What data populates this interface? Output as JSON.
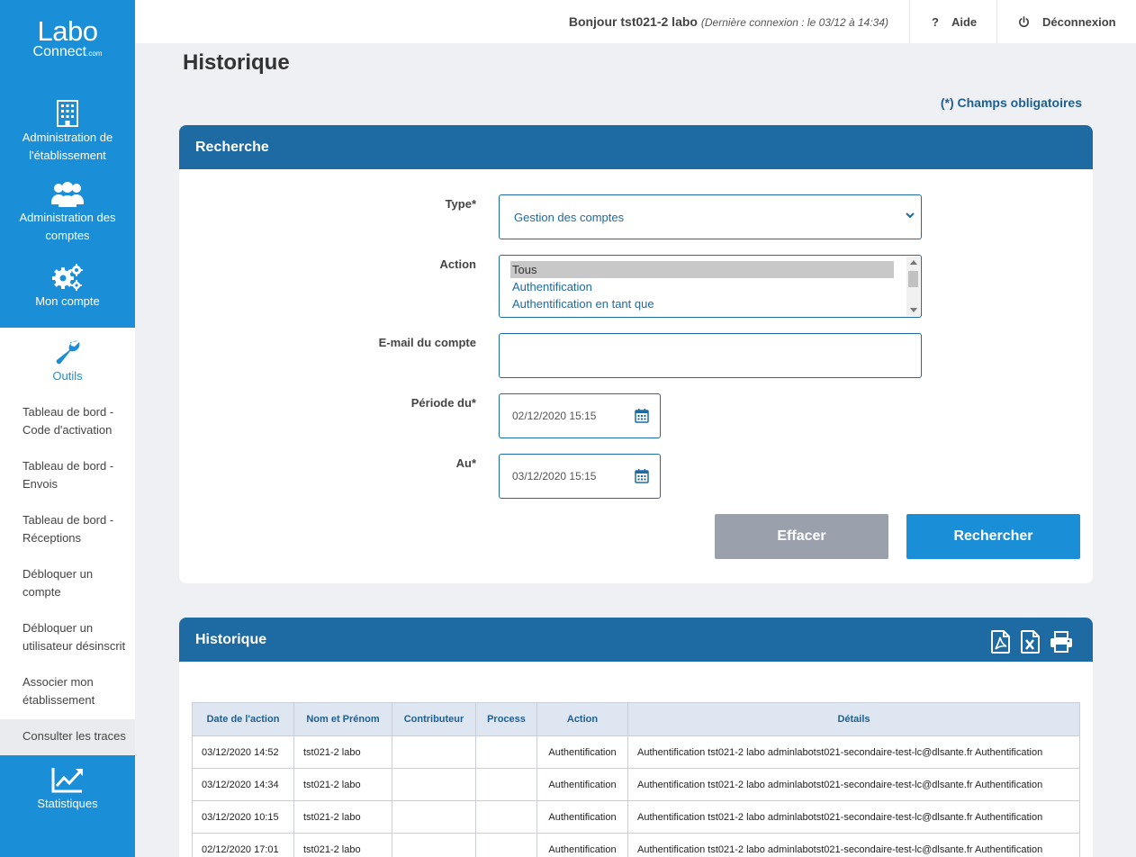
{
  "brand": {
    "line1": "Labo",
    "line2": "Connect",
    "suffix": ".com"
  },
  "nav": {
    "admin_etab": "Administration de l'établissement",
    "admin_comptes": "Administration des comptes",
    "mon_compte": "Mon compte",
    "outils": "Outils",
    "stats": "Statistiques",
    "sub_items": [
      "Tableau de bord - Code d'activation",
      "Tableau de bord - Envois",
      "Tableau de bord - Réceptions",
      "Débloquer un compte",
      "Débloquer un utilisateur désinscrit",
      "Associer mon établissement",
      "Consulter les traces"
    ]
  },
  "header": {
    "greeting": "Bonjour tst021-2 labo",
    "last_login": "(Dernière connexion : le 03/12 à 14:34)",
    "help": "Aide",
    "help_icon": "?",
    "logout": "Déconnexion"
  },
  "page": {
    "title": "Historique",
    "required_note": "(*) Champs obligatoires"
  },
  "search": {
    "title": "Recherche",
    "type_label": "Type*",
    "type_value": "Gestion des comptes",
    "action_label": "Action",
    "action_options": [
      "Tous",
      "Authentification",
      "Authentification en tant que"
    ],
    "email_label": "E-mail du compte",
    "email_value": "",
    "from_label": "Période du*",
    "from_value": "02/12/2020 15:15",
    "to_label": "Au*",
    "to_value": "03/12/2020 15:15",
    "clear_btn": "Effacer",
    "search_btn": "Rechercher"
  },
  "history": {
    "title": "Historique",
    "columns": [
      "Date de l'action",
      "Nom et Prénom",
      "Contributeur",
      "Process",
      "Action",
      "Détails"
    ],
    "rows": [
      [
        "03/12/2020 14:52",
        "tst021-2 labo",
        "",
        "",
        "Authentification",
        "Authentification tst021-2 labo adminlabotst021-secondaire-test-lc@dlsante.fr Authentification"
      ],
      [
        "03/12/2020 14:34",
        "tst021-2 labo",
        "",
        "",
        "Authentification",
        "Authentification tst021-2 labo adminlabotst021-secondaire-test-lc@dlsante.fr Authentification"
      ],
      [
        "03/12/2020 10:15",
        "tst021-2 labo",
        "",
        "",
        "Authentification",
        "Authentification tst021-2 labo adminlabotst021-secondaire-test-lc@dlsante.fr Authentification"
      ],
      [
        "02/12/2020 17:01",
        "tst021-2 labo",
        "",
        "",
        "Authentification",
        "Authentification tst021-2 labo adminlabotst021-secondaire-test-lc@dlsante.fr Authentification"
      ]
    ]
  },
  "colors": {
    "primary": "#1a8fd8",
    "panel_header": "#1e6aa3",
    "clear_btn": "#9aa1ad"
  }
}
